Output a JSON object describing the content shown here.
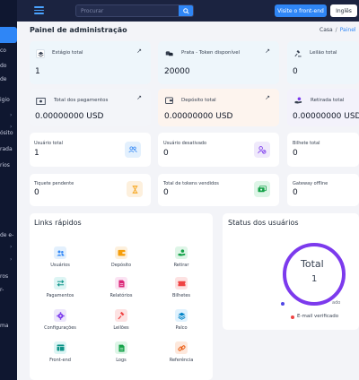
{
  "topbar": {
    "search_placeholder": "Procurar",
    "frontend_button": "Visite o front-end",
    "language_button": "Inglês"
  },
  "sidebar": {
    "partial_labels": [
      "co",
      "do",
      "de",
      "igio",
      "›",
      "›",
      "ósito",
      "rada",
      "rios",
      "de e-",
      "›",
      "›",
      "ros",
      "r-",
      "ma"
    ]
  },
  "header": {
    "title": "Painel de administração",
    "breadcrumb_home": "Casa",
    "breadcrumb_current": "Painel"
  },
  "top_cards": [
    {
      "label": "Estágio total",
      "value": "1",
      "icon": "layers-icon"
    },
    {
      "label": "Prata - Token disponível",
      "value": "20000",
      "icon": "coins-icon"
    },
    {
      "label": "Leilão total",
      "value": "0",
      "icon": "gavel-icon"
    }
  ],
  "money_cards": [
    {
      "label": "Total dos pagamentos",
      "value": "0.00000000 USD",
      "icon": "cash-icon"
    },
    {
      "label": "Depósito total",
      "value": "0.00000000 USD",
      "icon": "wallet-icon"
    },
    {
      "label": "Retirada total",
      "value": "0.00000000 USD",
      "icon": "hand-money-icon"
    }
  ],
  "stat_cards": [
    {
      "label": "Usuário total",
      "value": "1",
      "icon": "users-icon"
    },
    {
      "label": "Usuário desativado",
      "value": "0",
      "icon": "user-block-icon"
    },
    {
      "label": "Bilhete total",
      "value": "0",
      "icon": "ticket-icon"
    },
    {
      "label": "Tiquete pendente",
      "value": "0",
      "icon": "hourglass-icon"
    },
    {
      "label": "Total de tokens vendidos",
      "value": "0",
      "icon": "money-stack-icon"
    },
    {
      "label": "Gateway offline",
      "value": "0",
      "icon": "gateway-icon"
    }
  ],
  "quick_links": {
    "title": "Links rápidos",
    "items": [
      {
        "label": "Usuários",
        "icon": "users-icon"
      },
      {
        "label": "Depósito",
        "icon": "wallet-icon"
      },
      {
        "label": "Retirar",
        "icon": "hand-money-icon"
      },
      {
        "label": "Pagamentos",
        "icon": "transfer-icon"
      },
      {
        "label": "Relatórios",
        "icon": "report-icon"
      },
      {
        "label": "Bilhetes",
        "icon": "ticket-icon"
      },
      {
        "label": "Configurações",
        "icon": "gear-icon"
      },
      {
        "label": "Leilões",
        "icon": "gavel-icon"
      },
      {
        "label": "Palco",
        "icon": "layers-icon"
      },
      {
        "label": "Front-end",
        "icon": "browser-icon"
      },
      {
        "label": "Logs",
        "icon": "document-icon"
      },
      {
        "label": "Referência",
        "icon": "link-icon"
      }
    ]
  },
  "user_status": {
    "title": "Status dos usuários",
    "ring_label": "Total",
    "ring_value": "1",
    "legend_partial": "ado",
    "legend_email": "E-mail verificado",
    "ring_color": "#7c3aed",
    "email_dot_color": "#ef4444",
    "legend_dot_color": "#4f46e5"
  },
  "colors": {
    "accent": "#2f86f6",
    "sidebar_bg": "#0f1730",
    "topbar_bg": "#1b2340"
  }
}
